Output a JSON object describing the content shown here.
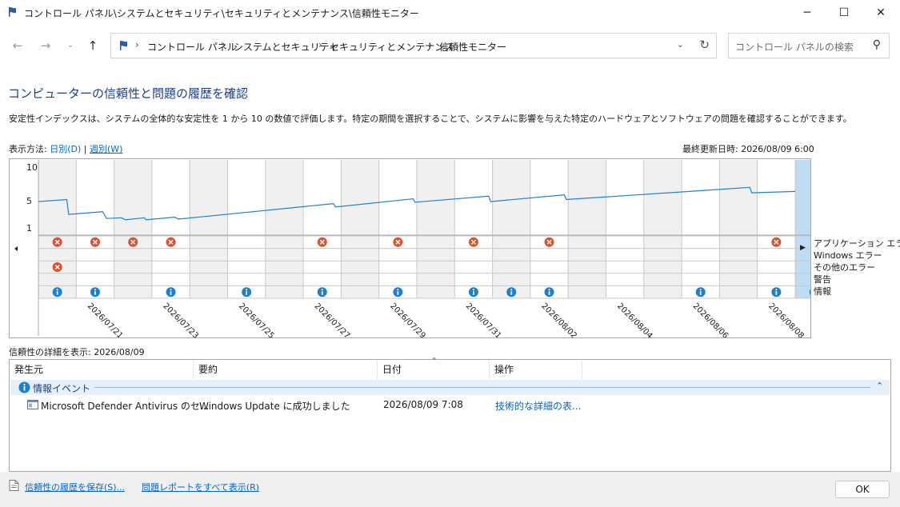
{
  "window": {
    "title": "コントロール パネル\\システムとセキュリティ\\セキュリティとメンテナンス\\信頼性モニター",
    "minimize": "─",
    "maximize": "☐",
    "close": "✕"
  },
  "nav": {
    "back_icon": "arrow-left-icon",
    "forward_icon": "arrow-right-icon",
    "recent_icon": "chevron-down-icon",
    "up_icon": "arrow-up-icon"
  },
  "breadcrumb": [
    "コントロール パネル",
    "システムとセキュリティ",
    "セキュリティとメンテナンス",
    "信頼性モニター"
  ],
  "search": {
    "placeholder": "コントロール パネルの検索"
  },
  "page": {
    "title": "コンピューターの信頼性と問題の履歴を確認",
    "description": "安定性インデックスは、システムの全体的な安定性を 1 から 10 の数値で評価します。特定の期間を選択することで、システムに影響を与えた特定のハードウェアとソフトウェアの問題を確認することができます。",
    "view_by_label": "表示方法:",
    "view_daily": "日別(D)",
    "view_separator": "|",
    "view_weekly": "週別(W)",
    "last_updated": "最終更新日時: 2026/08/09 6:00"
  },
  "chart_data": {
    "type": "line",
    "title": "",
    "ylim": [
      1,
      10
    ],
    "y_ticks": [
      "10",
      "5",
      "1"
    ],
    "x": [
      "2026/07/20",
      "2026/07/21",
      "2026/07/22",
      "2026/07/23",
      "2026/07/24",
      "2026/07/25",
      "2026/07/26",
      "2026/07/27",
      "2026/07/28",
      "2026/07/29",
      "2026/07/30",
      "2026/07/31",
      "2026/08/01",
      "2026/08/02",
      "2026/08/03",
      "2026/08/04",
      "2026/08/05",
      "2026/08/06",
      "2026/08/07",
      "2026/08/08",
      "2026/08/09"
    ],
    "x_tick_labels": [
      "2026/07/21",
      "2026/07/23",
      "2026/07/25",
      "2026/07/27",
      "2026/07/29",
      "2026/07/31",
      "2026/08/02",
      "2026/08/04",
      "2026/08/06",
      "2026/08/08"
    ],
    "x_tick_indices": [
      1,
      3,
      5,
      7,
      9,
      11,
      13,
      15,
      17,
      19
    ],
    "stability_index": [
      [
        0,
        4.9
      ],
      [
        0.75,
        5.2
      ],
      [
        0.8,
        3.0
      ],
      [
        1.7,
        3.4
      ],
      [
        1.8,
        2.4
      ],
      [
        2.2,
        2.5
      ],
      [
        2.3,
        2.2
      ],
      [
        2.8,
        2.5
      ],
      [
        2.85,
        2.2
      ],
      [
        3.6,
        2.6
      ],
      [
        3.7,
        2.3
      ],
      [
        7.8,
        4.6
      ],
      [
        7.85,
        4.1
      ],
      [
        9.9,
        5.3
      ],
      [
        9.95,
        4.8
      ],
      [
        11.9,
        5.7
      ],
      [
        11.95,
        4.9
      ],
      [
        13.9,
        5.9
      ],
      [
        13.95,
        5.2
      ],
      [
        18.8,
        7.0
      ],
      [
        18.85,
        6.2
      ],
      [
        20,
        6.4
      ]
    ],
    "rows": [
      "アプリケーション エラー",
      "Windows エラー",
      "その他のエラー",
      "警告",
      "情報"
    ],
    "events": {
      "app_errors": [
        0,
        1,
        2,
        3,
        7,
        9,
        11,
        13,
        19
      ],
      "windows_errors": [],
      "other_errors": [
        0
      ],
      "warnings": [],
      "info": [
        0,
        1,
        3,
        5,
        7,
        9,
        11,
        12,
        13,
        17,
        19,
        20
      ]
    },
    "selected_index": 20,
    "grid": true
  },
  "details": {
    "label": "信頼性の詳細を表示: 2026/08/09",
    "columns": [
      "発生元",
      "要約",
      "日付",
      "操作"
    ],
    "group_label": "情報イベント",
    "rows": [
      {
        "source": "Microsoft Defender Antivirus のセ...",
        "summary": "Windows Update に成功しました",
        "date": "2026/08/09 7:08",
        "action": "技術的な詳細の表..."
      }
    ]
  },
  "footer": {
    "save_link": "信頼性の履歴を保存(S)...",
    "reports_link": "問題レポートをすべて表示(R)",
    "ok_button": "OK"
  },
  "colors": {
    "accent": "#1e3f8c",
    "link": "#0066cc",
    "line": "#1e7fd0",
    "selected_column": "#bfdcf4",
    "error": "#e0502b",
    "info": "#1e7fd0"
  }
}
